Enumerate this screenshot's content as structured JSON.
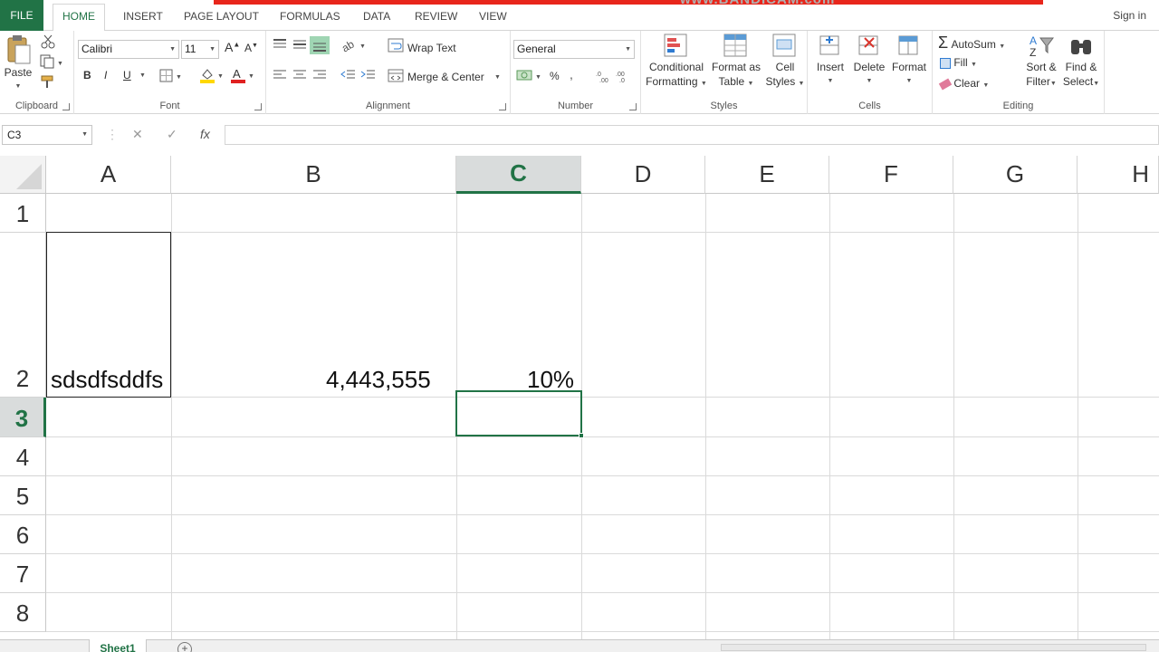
{
  "tabs": {
    "file": "FILE",
    "items": [
      "HOME",
      "INSERT",
      "PAGE LAYOUT",
      "FORMULAS",
      "DATA",
      "REVIEW",
      "VIEW"
    ],
    "active": "HOME",
    "sign_in": "Sign in",
    "watermark": "www.BANDICAM.com"
  },
  "ribbon": {
    "clipboard": {
      "paste": "Paste",
      "label": "Clipboard"
    },
    "font": {
      "name": "Calibri",
      "size": "11",
      "label": "Font",
      "bold": "B",
      "italic": "I",
      "underline": "U"
    },
    "alignment": {
      "wrap_text": "Wrap Text",
      "merge_center": "Merge & Center",
      "label": "Alignment"
    },
    "number": {
      "format": "General",
      "percent": "%",
      "label": "Number"
    },
    "styles": {
      "conditional": [
        "Conditional",
        "Formatting"
      ],
      "format_as_table": [
        "Format as",
        "Table"
      ],
      "cell_styles": [
        "Cell",
        "Styles"
      ],
      "label": "Styles"
    },
    "cells": {
      "insert": "Insert",
      "delete": "Delete",
      "format": "Format",
      "label": "Cells"
    },
    "editing": {
      "autosum": "AutoSum",
      "fill": "Fill",
      "clear": "Clear",
      "sort_filter": [
        "Sort &",
        "Filter"
      ],
      "find_select": [
        "Find &",
        "Select"
      ],
      "label": "Editing"
    }
  },
  "formula_bar": {
    "name_box": "C3",
    "cancel": "✕",
    "enter": "✓",
    "fx": "fx",
    "content": ""
  },
  "grid": {
    "columns": [
      "A",
      "B",
      "C",
      "D",
      "E",
      "F",
      "G",
      "H"
    ],
    "rows": [
      "1",
      "2",
      "3",
      "4",
      "5",
      "6",
      "7",
      "8"
    ],
    "selected_column": "C",
    "selected_row": "3",
    "cells": {
      "A2": "sdsdfsddfs",
      "B2": "4,443,555",
      "C2": "10%"
    }
  },
  "sheets": {
    "tabs": [
      "Sheet1"
    ],
    "add": "+"
  },
  "colors": {
    "accent": "#217346",
    "watermark_bar": "#e8261b"
  }
}
